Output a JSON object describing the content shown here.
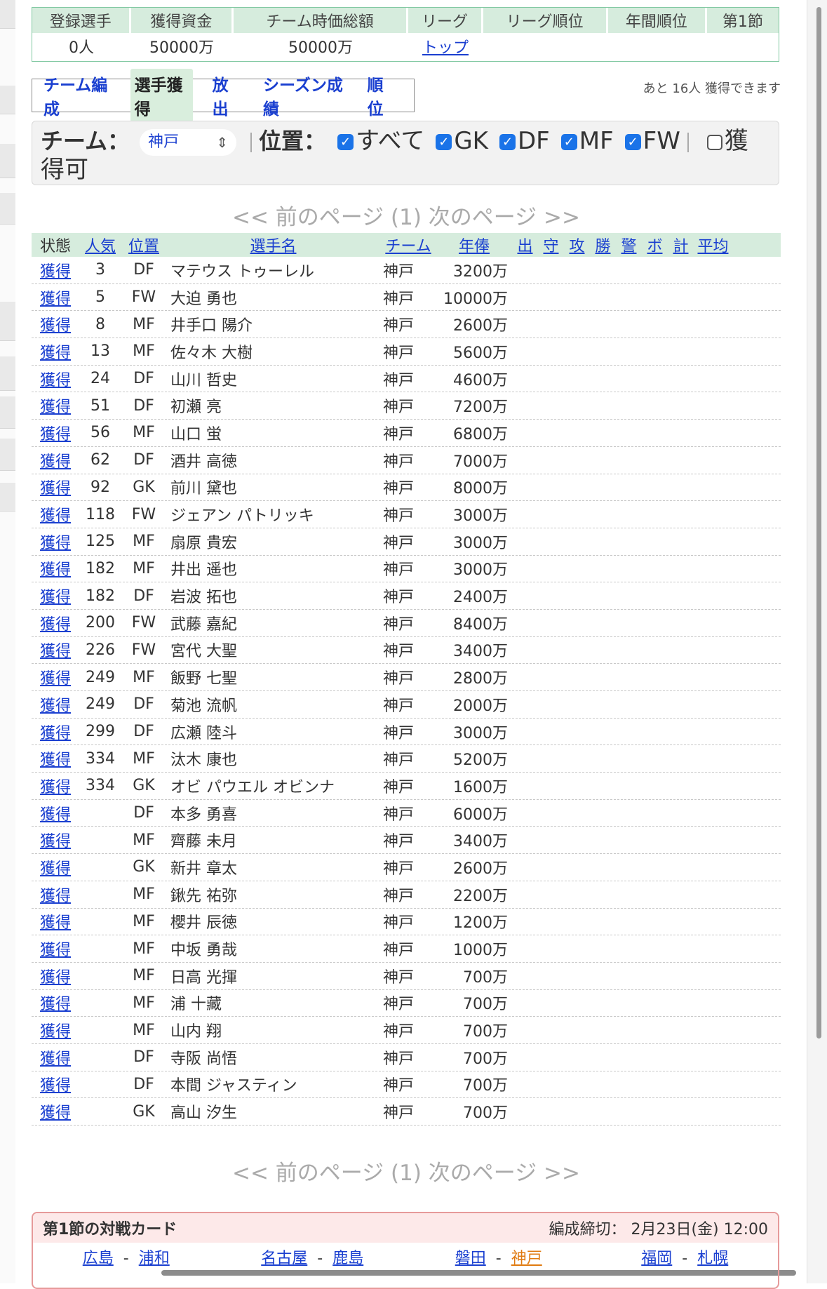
{
  "summary": {
    "headers": [
      "登録選手",
      "獲得資金",
      "チーム時価総額",
      "リーグ",
      "リーグ順位",
      "年間順位",
      "第1節"
    ],
    "values": [
      "0人",
      "50000万",
      "50000万",
      "トップ",
      "",
      "",
      ""
    ]
  },
  "nav": {
    "tabs": [
      "チーム編成",
      "選手獲得",
      "放出",
      "シーズン成績",
      "順位"
    ],
    "active": "選手獲得",
    "remaining_text": "あと 16人 獲得できます"
  },
  "filter": {
    "team_label": "チーム：",
    "team_value": "神戸",
    "position_label": "位置：",
    "options": [
      "すべて",
      "GK",
      "DF",
      "MF",
      "FW"
    ],
    "available_label": "獲得可"
  },
  "pager": {
    "text": "<< 前のページ (1) 次のページ >>"
  },
  "table": {
    "headers": [
      "状態",
      "人気",
      "位置",
      "選手名",
      "チーム",
      "年俸",
      "出",
      "守",
      "攻",
      "勝",
      "警",
      "ボ",
      "計",
      "平均"
    ],
    "rows": [
      [
        "獲得",
        "3",
        "DF",
        "マテウス トゥーレル",
        "神戸",
        "3200万"
      ],
      [
        "獲得",
        "5",
        "FW",
        "大迫 勇也",
        "神戸",
        "10000万"
      ],
      [
        "獲得",
        "8",
        "MF",
        "井手口 陽介",
        "神戸",
        "2600万"
      ],
      [
        "獲得",
        "13",
        "MF",
        "佐々木 大樹",
        "神戸",
        "5600万"
      ],
      [
        "獲得",
        "24",
        "DF",
        "山川 哲史",
        "神戸",
        "4600万"
      ],
      [
        "獲得",
        "51",
        "DF",
        "初瀬 亮",
        "神戸",
        "7200万"
      ],
      [
        "獲得",
        "56",
        "MF",
        "山口 蛍",
        "神戸",
        "6800万"
      ],
      [
        "獲得",
        "62",
        "DF",
        "酒井 高徳",
        "神戸",
        "7000万"
      ],
      [
        "獲得",
        "92",
        "GK",
        "前川 黛也",
        "神戸",
        "8000万"
      ],
      [
        "獲得",
        "118",
        "FW",
        "ジェアン パトリッキ",
        "神戸",
        "3000万"
      ],
      [
        "獲得",
        "125",
        "MF",
        "扇原 貴宏",
        "神戸",
        "3000万"
      ],
      [
        "獲得",
        "182",
        "MF",
        "井出 遥也",
        "神戸",
        "3000万"
      ],
      [
        "獲得",
        "182",
        "DF",
        "岩波 拓也",
        "神戸",
        "2400万"
      ],
      [
        "獲得",
        "200",
        "FW",
        "武藤 嘉紀",
        "神戸",
        "8400万"
      ],
      [
        "獲得",
        "226",
        "FW",
        "宮代 大聖",
        "神戸",
        "3400万"
      ],
      [
        "獲得",
        "249",
        "MF",
        "飯野 七聖",
        "神戸",
        "2800万"
      ],
      [
        "獲得",
        "249",
        "DF",
        "菊池 流帆",
        "神戸",
        "2000万"
      ],
      [
        "獲得",
        "299",
        "DF",
        "広瀬 陸斗",
        "神戸",
        "3000万"
      ],
      [
        "獲得",
        "334",
        "MF",
        "汰木 康也",
        "神戸",
        "5200万"
      ],
      [
        "獲得",
        "334",
        "GK",
        "オビ パウエル オビンナ",
        "神戸",
        "1600万"
      ],
      [
        "獲得",
        "",
        "DF",
        "本多 勇喜",
        "神戸",
        "6000万"
      ],
      [
        "獲得",
        "",
        "MF",
        "齊藤 未月",
        "神戸",
        "3400万"
      ],
      [
        "獲得",
        "",
        "GK",
        "新井 章太",
        "神戸",
        "2600万"
      ],
      [
        "獲得",
        "",
        "MF",
        "鍬先 祐弥",
        "神戸",
        "2200万"
      ],
      [
        "獲得",
        "",
        "MF",
        "櫻井 辰徳",
        "神戸",
        "1200万"
      ],
      [
        "獲得",
        "",
        "MF",
        "中坂 勇哉",
        "神戸",
        "1000万"
      ],
      [
        "獲得",
        "",
        "MF",
        "日高 光揮",
        "神戸",
        "700万"
      ],
      [
        "獲得",
        "",
        "MF",
        "浦 十藏",
        "神戸",
        "700万"
      ],
      [
        "獲得",
        "",
        "MF",
        "山内 翔",
        "神戸",
        "700万"
      ],
      [
        "獲得",
        "",
        "DF",
        "寺阪 尚悟",
        "神戸",
        "700万"
      ],
      [
        "獲得",
        "",
        "DF",
        "本間 ジャスティン",
        "神戸",
        "700万"
      ],
      [
        "獲得",
        "",
        "GK",
        "高山 汐生",
        "神戸",
        "700万"
      ]
    ]
  },
  "match": {
    "title": "第1節の対戦カード",
    "deadline": "編成締切： 2月23日(金) 12:00",
    "pairs": [
      [
        "広島",
        "浦和"
      ],
      [
        "名古屋",
        "鹿島"
      ],
      [
        "磐田",
        "神戸"
      ],
      [
        "福岡",
        "札幌"
      ]
    ]
  },
  "colors": {
    "link": "#1a3fd0",
    "header_green": "#d6ecdd",
    "highlight_orange": "#e07a10",
    "match_border": "#e69a9a"
  }
}
